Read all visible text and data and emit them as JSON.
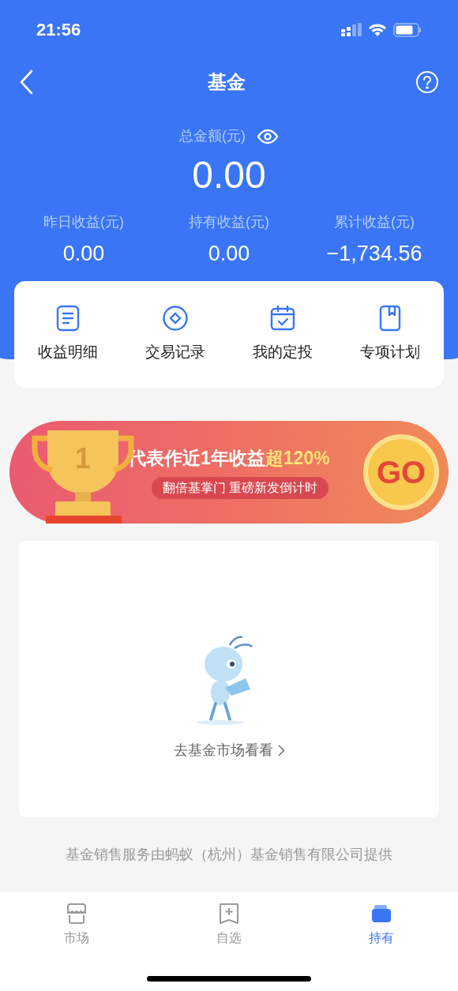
{
  "status_bar": {
    "time": "21:56"
  },
  "nav": {
    "title": "基金"
  },
  "summary": {
    "label": "总金额(元)",
    "amount": "0.00",
    "stats": [
      {
        "label": "昨日收益(元)",
        "value": "0.00"
      },
      {
        "label": "持有收益(元)",
        "value": "0.00"
      },
      {
        "label": "累计收益(元)",
        "value": "−1,734.56"
      }
    ]
  },
  "shortcuts": [
    {
      "kind": "doc",
      "label": "收益明细"
    },
    {
      "kind": "diamond",
      "label": "交易记录"
    },
    {
      "kind": "calendar",
      "label": "我的定投"
    },
    {
      "kind": "bookmark",
      "label": "专项计划"
    }
  ],
  "banner": {
    "rank": "1",
    "headline": "代表作近1年收益",
    "highlight": "超120%",
    "subtitle": "翻倍基掌门 重磅新发倒计时",
    "button": "GO"
  },
  "empty_state": {
    "link": "去基金市场看看"
  },
  "footer": "基金销售服务由蚂蚁（杭州）基金销售有限公司提供",
  "tab_bar": [
    {
      "kind": "market",
      "label": "市场",
      "selected": false
    },
    {
      "kind": "watch",
      "label": "自选",
      "selected": false
    },
    {
      "kind": "hold",
      "label": "持有",
      "selected": true
    }
  ]
}
